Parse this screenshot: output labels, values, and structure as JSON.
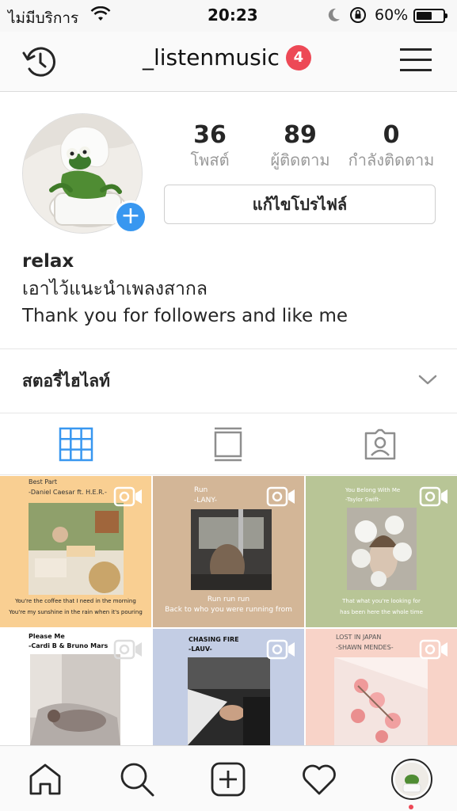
{
  "status_bar": {
    "carrier": "ไม่มีบริการ",
    "time": "20:23",
    "battery_percent": "60%",
    "battery_level": 0.6
  },
  "header": {
    "username": "_listenmusic",
    "notification_count": "4"
  },
  "profile": {
    "posts_count": "36",
    "posts_label": "โพสต์",
    "followers_count": "89",
    "followers_label": "ผู้ติดตาม",
    "following_count": "0",
    "following_label": "กำลังติดตาม",
    "edit_button": "แก้ไขโปรไฟล์",
    "name": "relax",
    "bio_line1": "เอาไว้แนะนำเพลงสากล",
    "bio_line2": "Thank you for followers and like me"
  },
  "highlights": {
    "title": "สตอรี่ไฮไลท์"
  },
  "posts": [
    {
      "top1": "Best Part",
      "top2": "-Daniel Caesar ft. H.E.R.-",
      "bottom1": "You're the coffee that I need in the morning",
      "bottom2": "You're my sunshine in the rain when it's pouring",
      "bg": "#f9cf92"
    },
    {
      "top1": "Run",
      "top2": "-LANY-",
      "bottom1": "Run run run",
      "bottom2": "Back to who you were running from",
      "bg": "#d3b697"
    },
    {
      "top1": "You Belong With Me",
      "top2": "-Taylor Swift-",
      "bottom1": "That what you're looking for",
      "bottom2": "has been here the whole time",
      "bg": "#b8c596"
    },
    {
      "top1": "Please Me",
      "top2": "-Cardi B & Bruno Mars",
      "bottom1": "",
      "bottom2": "",
      "bg": "#ffffff"
    },
    {
      "top1": "CHASING FIRE",
      "top2": "-LAUV-",
      "bottom1": "",
      "bottom2": "",
      "bg": "#c3cde4"
    },
    {
      "top1": "LOST IN JAPAN",
      "top2": "-SHAWN MENDES-",
      "bottom1": "",
      "bottom2": "",
      "bg": "#f8d3c8"
    }
  ],
  "colors": {
    "accent_blue": "#3897f0",
    "badge_red": "#ed4956",
    "text": "#262626",
    "muted": "#999999"
  },
  "icons": {
    "history": "history-icon",
    "menu": "menu-icon",
    "grid": "grid-icon",
    "list": "list-view-icon",
    "tagged": "tagged-icon",
    "home": "home-icon",
    "search": "search-icon",
    "add": "add-post-icon",
    "heart": "heart-icon",
    "video": "video-icon"
  }
}
